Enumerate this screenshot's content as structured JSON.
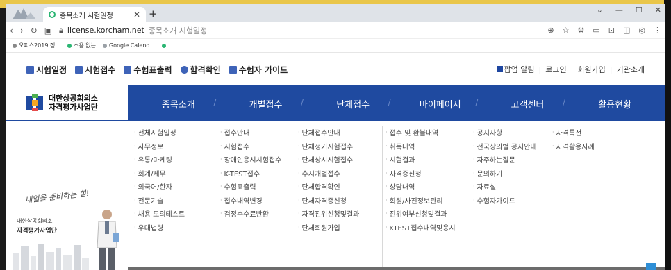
{
  "browser": {
    "tab_title": "종목소개 시험일정",
    "address_host": "license.korcham.net",
    "address_path": "종목소개 시험일정",
    "bookmarks": [
      "오피스2019 정...",
      "소용 없는",
      "Google Calend...",
      ""
    ],
    "bookmark_colors": [
      "#888888",
      "#2bb673",
      "#9aa0a6",
      "#2bb673"
    ]
  },
  "util_left": [
    "시험일정",
    "시험접수",
    "수험표출력",
    "합격확인",
    "수험자 가이드"
  ],
  "util_right": [
    "팝업 알림",
    "로그인",
    "회원가입",
    "기관소개"
  ],
  "logo": {
    "line1": "대한상공회의소",
    "line2": "자격평가사업단"
  },
  "menu": [
    "종목소개",
    "개별접수",
    "단체접수",
    "마이페이지",
    "고객센터",
    "활용현황"
  ],
  "promo": {
    "slogan": "내일을 준비하는 힘!",
    "org": "대한상공회의소",
    "sub": "자격평가사업단"
  },
  "columns": [
    [
      "전체시험일정",
      "사무정보",
      "유통/마케팅",
      "회계/세무",
      "외국어/한자",
      "전문기술",
      "채용 모의테스트",
      "우대법령"
    ],
    [
      "접수안내",
      "시험접수",
      "장애인응시시험접수",
      "K-TEST접수",
      "수험표출력",
      "접수내역변경",
      "검정수수료반환"
    ],
    [
      "단체접수안내",
      "단체정기시험접수",
      "단체상시시험접수",
      "수시개별접수",
      "단체합격확인",
      "단체자격증신청",
      "자격진위신청및결과",
      "단체회원가입"
    ],
    [
      "접수 및 환불내역",
      "취득내역",
      "시험결과",
      "자격증신청",
      "상담내역",
      "회원/사진정보관리",
      "진위여부신청및결과",
      "KTEST접수내역및응시"
    ],
    [
      "공지사항",
      "전국상의별 공지안내",
      "자주하는질문",
      "문의하기",
      "자료실",
      "수험자가이드"
    ],
    [
      "자격특전",
      "자격활용사례"
    ]
  ]
}
